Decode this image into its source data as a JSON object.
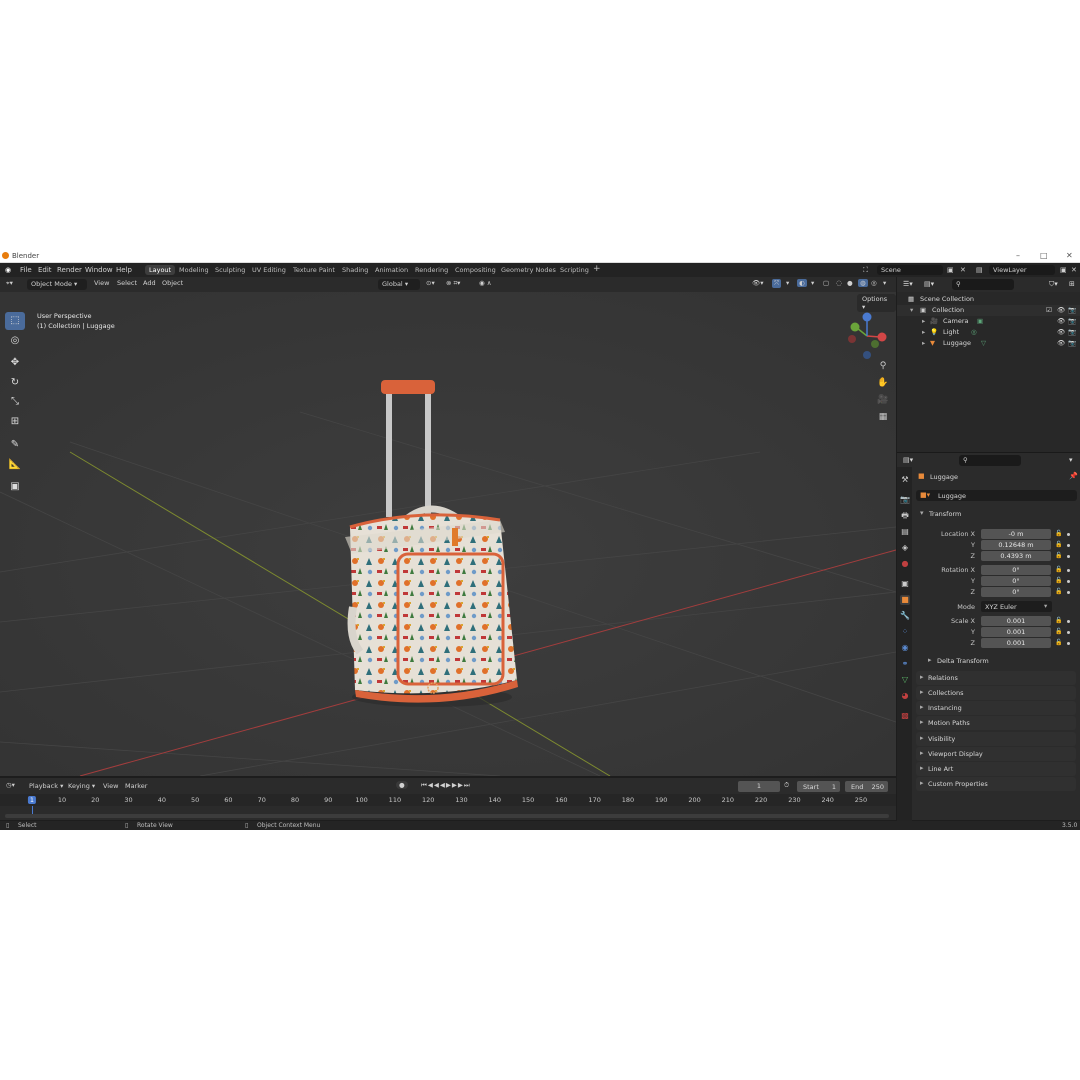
{
  "window": {
    "title": "Blender"
  },
  "menu": [
    "File",
    "Edit",
    "Render",
    "Window",
    "Help"
  ],
  "workspaces": [
    "Layout",
    "Modeling",
    "Sculpting",
    "UV Editing",
    "Texture Paint",
    "Shading",
    "Animation",
    "Rendering",
    "Compositing",
    "Geometry Nodes",
    "Scripting"
  ],
  "scene": {
    "name": "Scene",
    "view_layer": "ViewLayer"
  },
  "viewport_header": {
    "mode": "Object Mode",
    "view": "View",
    "select": "Select",
    "add": "Add",
    "object": "Object",
    "orientation": "Global",
    "options": "Options"
  },
  "viewport": {
    "perspective": "User Perspective",
    "collection_info": "(1) Collection | Luggage"
  },
  "outliner": {
    "root": "Scene Collection",
    "collection": "Collection",
    "items": [
      "Camera",
      "Light",
      "Luggage"
    ]
  },
  "properties": {
    "object_name": "Luggage",
    "data_name": "Luggage",
    "transform_label": "Transform",
    "location_label": "Location X",
    "rotation_label": "Rotation X",
    "scale_label": "Scale X",
    "y": "Y",
    "z": "Z",
    "location": [
      "-0 m",
      "0.12648 m",
      "0.4393 m"
    ],
    "rotation": [
      "0°",
      "0°",
      "0°"
    ],
    "mode_label": "Mode",
    "mode_value": "XYZ Euler",
    "scale": [
      "0.001",
      "0.001",
      "0.001"
    ],
    "delta_transform": "Delta Transform",
    "panels": [
      "Relations",
      "Collections",
      "Instancing",
      "Motion Paths",
      "Visibility",
      "Viewport Display",
      "Line Art",
      "Custom Properties"
    ]
  },
  "timeline": {
    "playback": "Playback",
    "keying": "Keying",
    "view": "View",
    "marker": "Marker",
    "current_frame": "1",
    "start_label": "Start",
    "start": "1",
    "end_label": "End",
    "end": "250",
    "ticks": [
      "1",
      "10",
      "20",
      "30",
      "40",
      "50",
      "60",
      "70",
      "80",
      "90",
      "100",
      "110",
      "120",
      "130",
      "140",
      "150",
      "160",
      "170",
      "180",
      "190",
      "200",
      "210",
      "220",
      "230",
      "240",
      "250"
    ]
  },
  "status": {
    "select": "Select",
    "rotate": "Rotate View",
    "context": "Object Context Menu",
    "version": "3.5.0"
  }
}
